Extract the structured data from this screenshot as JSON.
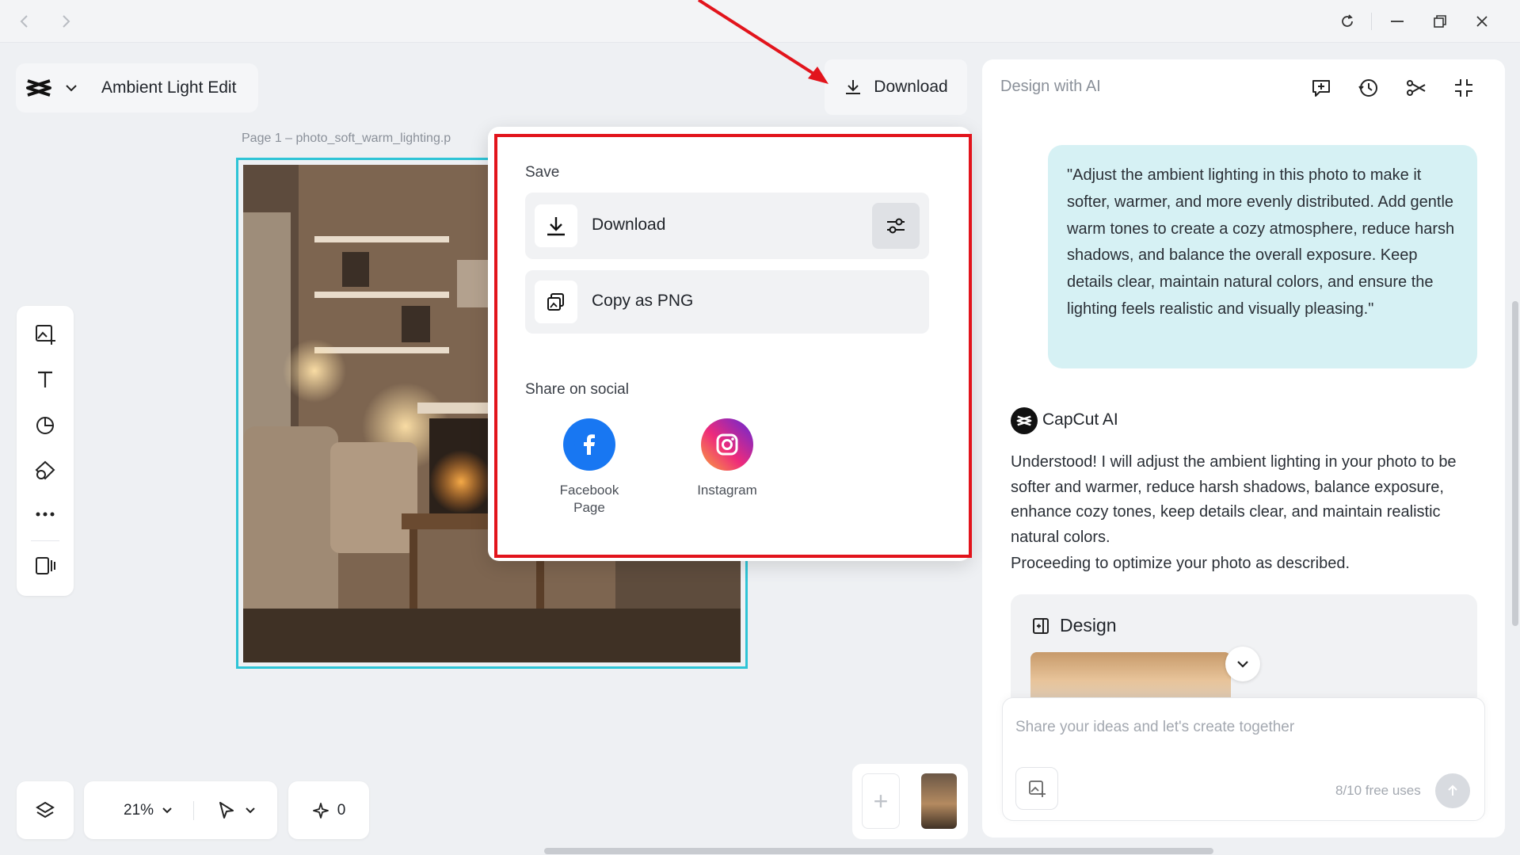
{
  "project": {
    "title": "Ambient Light Edit",
    "page_label": "Page 1 –  photo_soft_warm_lighting.p"
  },
  "toolbar": {
    "download_label": "Download"
  },
  "popup": {
    "save_section": "Save",
    "download_option": "Download",
    "copy_option": "Copy as PNG",
    "share_section": "Share on social",
    "facebook_label": "Facebook Page",
    "instagram_label": "Instagram"
  },
  "canvas_controls": {
    "zoom": "21%",
    "credits": "0"
  },
  "ai_panel": {
    "title": "Design with AI",
    "user_message": "\"Adjust the ambient lighting in this photo to make it softer, warmer, and more evenly distributed. Add gentle warm tones to create a cozy atmosphere, reduce harsh shadows, and balance the overall exposure. Keep details clear, maintain natural colors, and ensure the lighting feels realistic and visually pleasing.\"",
    "assistant_name": "CapCut AI",
    "assistant_reply": "Understood! I will adjust the ambient lighting in your photo to be softer and warmer, reduce harsh shadows, balance exposure, enhance cozy tones, keep details clear, and maintain realistic natural colors.",
    "assistant_reply_2": "Proceeding to optimize your photo as described.",
    "design_card_title": "Design",
    "input_placeholder": "Share your ideas and let's create together",
    "free_uses": "8/10 free uses"
  },
  "colors": {
    "highlight_border": "#e2141c",
    "selection_border": "#2ec4d6",
    "user_bubble": "#d6f1f4",
    "facebook": "#1877f2"
  },
  "icons": [
    "back-icon",
    "forward-icon",
    "refresh-icon",
    "minimize-icon",
    "restore-icon",
    "close-icon",
    "capcut-logo",
    "chevron-down-icon",
    "download-icon",
    "settings-sliders-icon",
    "copy-icon",
    "facebook-icon",
    "instagram-icon",
    "image-add-icon",
    "text-icon",
    "sticker-icon",
    "shapes-icon",
    "more-icon",
    "panel-icon",
    "layers-icon",
    "pointer-icon",
    "sparkle-icon",
    "chat-add-icon",
    "history-icon",
    "share-icon",
    "minimize-panel-icon",
    "image-upload-icon",
    "send-icon",
    "arrow-annotation"
  ]
}
